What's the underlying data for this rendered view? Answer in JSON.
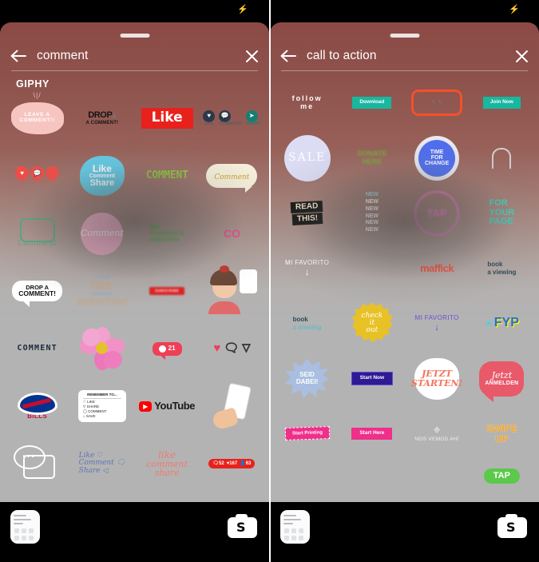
{
  "meta": {
    "app": "instagram-story-sticker-search",
    "screenshot_width": 675,
    "screenshot_height": 703,
    "panel_count": 2
  },
  "colors": {
    "sheet_top": "#8c4a45",
    "sheet_bottom": "#b3b3b3",
    "bar_background": "#000000",
    "text_on_header": "#ffffff",
    "status_icon_green": "#1faa6a",
    "divider": "#ffffff"
  },
  "panels": [
    {
      "id": "left",
      "statusbar": {
        "charging_icon": "bolt-icon"
      },
      "header": {
        "back_icon": "back-arrow-icon",
        "query": "comment",
        "placeholder": "Search",
        "close_icon": "close-icon",
        "grabber": "drag-handle"
      },
      "provider_label": "GIPHY",
      "stickers": [
        {
          "row": 1,
          "col": 1,
          "name": "leave-a-comment-blob",
          "text": "LEAVE A COMMENT!!",
          "bg": "#f7c5c0",
          "fg": "#ffffff"
        },
        {
          "row": 1,
          "col": 2,
          "name": "drop-a-comment-text",
          "text": "DROP A COMMENT!",
          "bg": "transparent",
          "fg": "#1c1c1c"
        },
        {
          "row": 1,
          "col": 3,
          "name": "like-red-banner",
          "text": "Like",
          "bg": "#e8211c",
          "fg": "#ffffff"
        },
        {
          "row": 1,
          "col": 4,
          "name": "like-comment-share-icons",
          "text": "LIKE COMMENT SHARE",
          "bg": "#2b3a4a",
          "fg": "#ffffff"
        },
        {
          "row": 2,
          "col": 1,
          "name": "three-red-circles",
          "text": "Like Comment",
          "bg": "#f24c46",
          "fg": "#ffffff"
        },
        {
          "row": 2,
          "col": 2,
          "name": "like-comment-share-blue-blob",
          "text": "Like Comment Share",
          "bg": "#63cbe6",
          "fg": "#ffffff"
        },
        {
          "row": 2,
          "col": 3,
          "name": "comment-green-text",
          "text": "COMMENT",
          "bg": "transparent",
          "fg": "#8fc63d"
        },
        {
          "row": 2,
          "col": 4,
          "name": "comment-cream-bubble",
          "text": "Comment",
          "bg": "#f6efdc",
          "fg": "#c9a227"
        },
        {
          "row": 3,
          "col": 1,
          "name": "comment-green-outline-bubble",
          "text": "Comment",
          "bg": "transparent",
          "fg": "#5aa882"
        },
        {
          "row": 3,
          "col": 2,
          "name": "comment-pink-circle",
          "text": "Comment",
          "bg": "#f8b2cc",
          "fg": "#ffffff"
        },
        {
          "row": 3,
          "col": 3,
          "name": "like-comment-subscribe-green",
          "text": "like comment & subscribe",
          "bg": "transparent",
          "fg": "#49b44a"
        },
        {
          "row": 3,
          "col": 4,
          "name": "co-pink-green-text",
          "text": "CO",
          "bg": "transparent",
          "fg": "#ef4a8c"
        },
        {
          "row": 4,
          "col": 1,
          "name": "drop-a-comment-bubble",
          "text": "DROP A COMMENT!",
          "bg": "#ffffff",
          "fg": "#111111"
        },
        {
          "row": 4,
          "col": 2,
          "name": "please-like-comment-subscribe",
          "text": "Please like comment subscribe",
          "bg": "transparent",
          "fg": "#c9a27a"
        },
        {
          "row": 4,
          "col": 3,
          "name": "subscribe-red-button",
          "text": "SUBSCRIBE",
          "bg": "#e02020",
          "fg": "#ffffff"
        },
        {
          "row": 4,
          "col": 4,
          "name": "girl-speech-bubble-illustration",
          "text": "",
          "bg": "#ffffff",
          "fg": "#e06a6a"
        },
        {
          "row": 5,
          "col": 1,
          "name": "comment-dark-text",
          "text": "COMMENT",
          "bg": "transparent",
          "fg": "#1b2a3a"
        },
        {
          "row": 5,
          "col": 2,
          "name": "pink-flower-illustration",
          "text": "",
          "bg": "#f28ec6",
          "fg": "#e8c73a"
        },
        {
          "row": 5,
          "col": 3,
          "name": "comment-count-badge",
          "text": "21",
          "bg": "#ef3f56",
          "fg": "#ffffff"
        },
        {
          "row": 5,
          "col": 4,
          "name": "heart-comment-send-icons",
          "text": "",
          "bg": "transparent",
          "fg": "#ef3f56"
        },
        {
          "row": 6,
          "col": 1,
          "name": "buffalo-bills-logo",
          "text": "BUFFALO BILLS",
          "bg": "#00338d",
          "fg": "#c60c30"
        },
        {
          "row": 6,
          "col": 2,
          "name": "remember-to-checklist",
          "text": "REMEMBER TO... LIKE SHARE COMMENT SAVE",
          "bg": "#ffffff",
          "fg": "#222222"
        },
        {
          "row": 6,
          "col": 3,
          "name": "youtube-logo",
          "text": "YouTube",
          "bg": "#ff0000",
          "fg": "#1a1a1a"
        },
        {
          "row": 6,
          "col": 4,
          "name": "hand-holding-phone-illustration",
          "text": "",
          "bg": "#ffffff",
          "fg": "#e8b58d"
        },
        {
          "row": 7,
          "col": 1,
          "name": "comment-outline-bubbles",
          "text": "",
          "bg": "transparent",
          "fg": "#ffffff"
        },
        {
          "row": 7,
          "col": 2,
          "name": "like-comment-share-blue-script",
          "text": "Like Comment Share",
          "bg": "transparent",
          "fg": "#5b77b5"
        },
        {
          "row": 7,
          "col": 3,
          "name": "like-comment-share-coral-script",
          "text": "like comment share",
          "bg": "transparent",
          "fg": "#f4796c"
        },
        {
          "row": 7,
          "col": 4,
          "name": "engagement-stats-badge",
          "text": "52 167 63",
          "bg": "#e8211c",
          "fg": "#ffffff"
        }
      ],
      "bottombar": {
        "keyboard_icon": "keyboard-icon",
        "camera_flip_icon": "camera-flip-icon"
      }
    },
    {
      "id": "right",
      "statusbar": {
        "charging_icon": "bolt-icon"
      },
      "header": {
        "back_icon": "back-arrow-icon",
        "query": "call to action",
        "placeholder": "Search",
        "close_icon": "close-icon",
        "grabber": "drag-handle"
      },
      "provider_label": "",
      "stickers": [
        {
          "row": 1,
          "col": 1,
          "name": "follow-me-text",
          "text": "follow me",
          "bg": "transparent",
          "fg": "#ffffff"
        },
        {
          "row": 1,
          "col": 2,
          "name": "download-teal-button",
          "text": "Download",
          "bg": "#18b7a0",
          "fg": "#ffffff"
        },
        {
          "row": 1,
          "col": 3,
          "name": "orange-outline-box",
          "text": "",
          "bg": "transparent",
          "fg": "#f4502a"
        },
        {
          "row": 1,
          "col": 4,
          "name": "join-now-teal-button",
          "text": "Join Now",
          "bg": "#18b7a0",
          "fg": "#ffffff"
        },
        {
          "row": 2,
          "col": 1,
          "name": "sale-lavender-circle",
          "text": "SALE",
          "bg": "#dcdcf5",
          "fg": "#ffffff"
        },
        {
          "row": 2,
          "col": 2,
          "name": "donate-here-text",
          "text": "DONATE HERE",
          "bg": "transparent",
          "fg": "#7aa83c"
        },
        {
          "row": 2,
          "col": 3,
          "name": "time-for-change-blue-circle",
          "text": "TIME FOR CHANGE",
          "bg": "#4f6ef0",
          "fg": "#ffffff"
        },
        {
          "row": 2,
          "col": 4,
          "name": "arch-outline-shape",
          "text": "",
          "bg": "transparent",
          "fg": "#cfcfcf"
        },
        {
          "row": 3,
          "col": 1,
          "name": "read-this-black-banner",
          "text": "READ THIS!",
          "bg": "#151515",
          "fg": "#f3e6c8"
        },
        {
          "row": 3,
          "col": 2,
          "name": "new-repeated-list",
          "text": "NEW NEW NEW NEW NEW NEW",
          "bg": "transparent",
          "fg": "#ffffff"
        },
        {
          "row": 3,
          "col": 3,
          "name": "tap-pink-circle",
          "text": "TAP",
          "bg": "transparent",
          "fg": "#ef7fd0"
        },
        {
          "row": 3,
          "col": 4,
          "name": "for-your-page-teal-text",
          "text": "FOR YOUR PAGE",
          "bg": "transparent",
          "fg": "#3fd3bd"
        },
        {
          "row": 4,
          "col": 1,
          "name": "mi-favorito-white-arrow",
          "text": "MI FAVORITO",
          "bg": "transparent",
          "fg": "#ffffff"
        },
        {
          "row": 4,
          "col": 2,
          "name": "blank-cell-a",
          "text": "",
          "bg": "transparent",
          "fg": "#b3b3b3"
        },
        {
          "row": 4,
          "col": 3,
          "name": "maffick-logo",
          "text": "maffick",
          "bg": "transparent",
          "fg": "#f4503c"
        },
        {
          "row": 4,
          "col": 4,
          "name": "book-a-viewing-dark",
          "text": "book a viewing",
          "bg": "transparent",
          "fg": "#2b4a56"
        },
        {
          "row": 5,
          "col": 1,
          "name": "book-a-viewing-blue",
          "text": "book a viewing",
          "bg": "transparent",
          "fg": "#2b4a56"
        },
        {
          "row": 5,
          "col": 2,
          "name": "check-it-out-yellow-badge",
          "text": "check it out",
          "bg": "#e8c126",
          "fg": "#ffffff"
        },
        {
          "row": 5,
          "col": 3,
          "name": "mi-favorito-purple-arrow",
          "text": "MI FAVORITO",
          "bg": "transparent",
          "fg": "#6f4fd0"
        },
        {
          "row": 5,
          "col": 4,
          "name": "fyp-blue-yellow",
          "text": "FYP",
          "bg": "#ffe600",
          "fg": "#1f6fe0"
        },
        {
          "row": 6,
          "col": 1,
          "name": "seid-dabei-blue-starburst",
          "text": "SEID DABEI!",
          "bg": "#a9bee0",
          "fg": "#ffffff"
        },
        {
          "row": 6,
          "col": 2,
          "name": "start-now-purple-button",
          "text": "Start Now",
          "bg": "#2e1a94",
          "fg": "#ffffff"
        },
        {
          "row": 6,
          "col": 3,
          "name": "jetzt-starten-white-blob",
          "text": "JETZT STARTEN!",
          "bg": "#ffffff",
          "fg": "#f4735e"
        },
        {
          "row": 6,
          "col": 4,
          "name": "jetzt-anmelden-red-bubble",
          "text": "Jetzt ANMELDEN",
          "bg": "#e8596a",
          "fg": "#ffffff"
        },
        {
          "row": 7,
          "col": 1,
          "name": "start-printing-pink-button",
          "text": "Start Printing",
          "bg": "#ef2f8a",
          "fg": "#ffffff"
        },
        {
          "row": 7,
          "col": 2,
          "name": "start-here-pink-button",
          "text": "Start Here",
          "bg": "#ef2f8a",
          "fg": "#ffffff"
        },
        {
          "row": 7,
          "col": 3,
          "name": "nos-vemos-ahi-pin",
          "text": "NOS VEMOS AHÍ",
          "bg": "transparent",
          "fg": "#f0f0f0"
        },
        {
          "row": 7,
          "col": 4,
          "name": "swipe-up-orange",
          "text": "SWIPE UP",
          "bg": "transparent",
          "fg": "#f5a623"
        },
        {
          "row": 8,
          "col": 4,
          "name": "tap-green-partial",
          "text": "TAP",
          "bg": "#5bc94a",
          "fg": "#ffffff"
        }
      ],
      "bottombar": {
        "keyboard_icon": "keyboard-icon",
        "camera_flip_icon": "camera-flip-icon"
      }
    }
  ]
}
